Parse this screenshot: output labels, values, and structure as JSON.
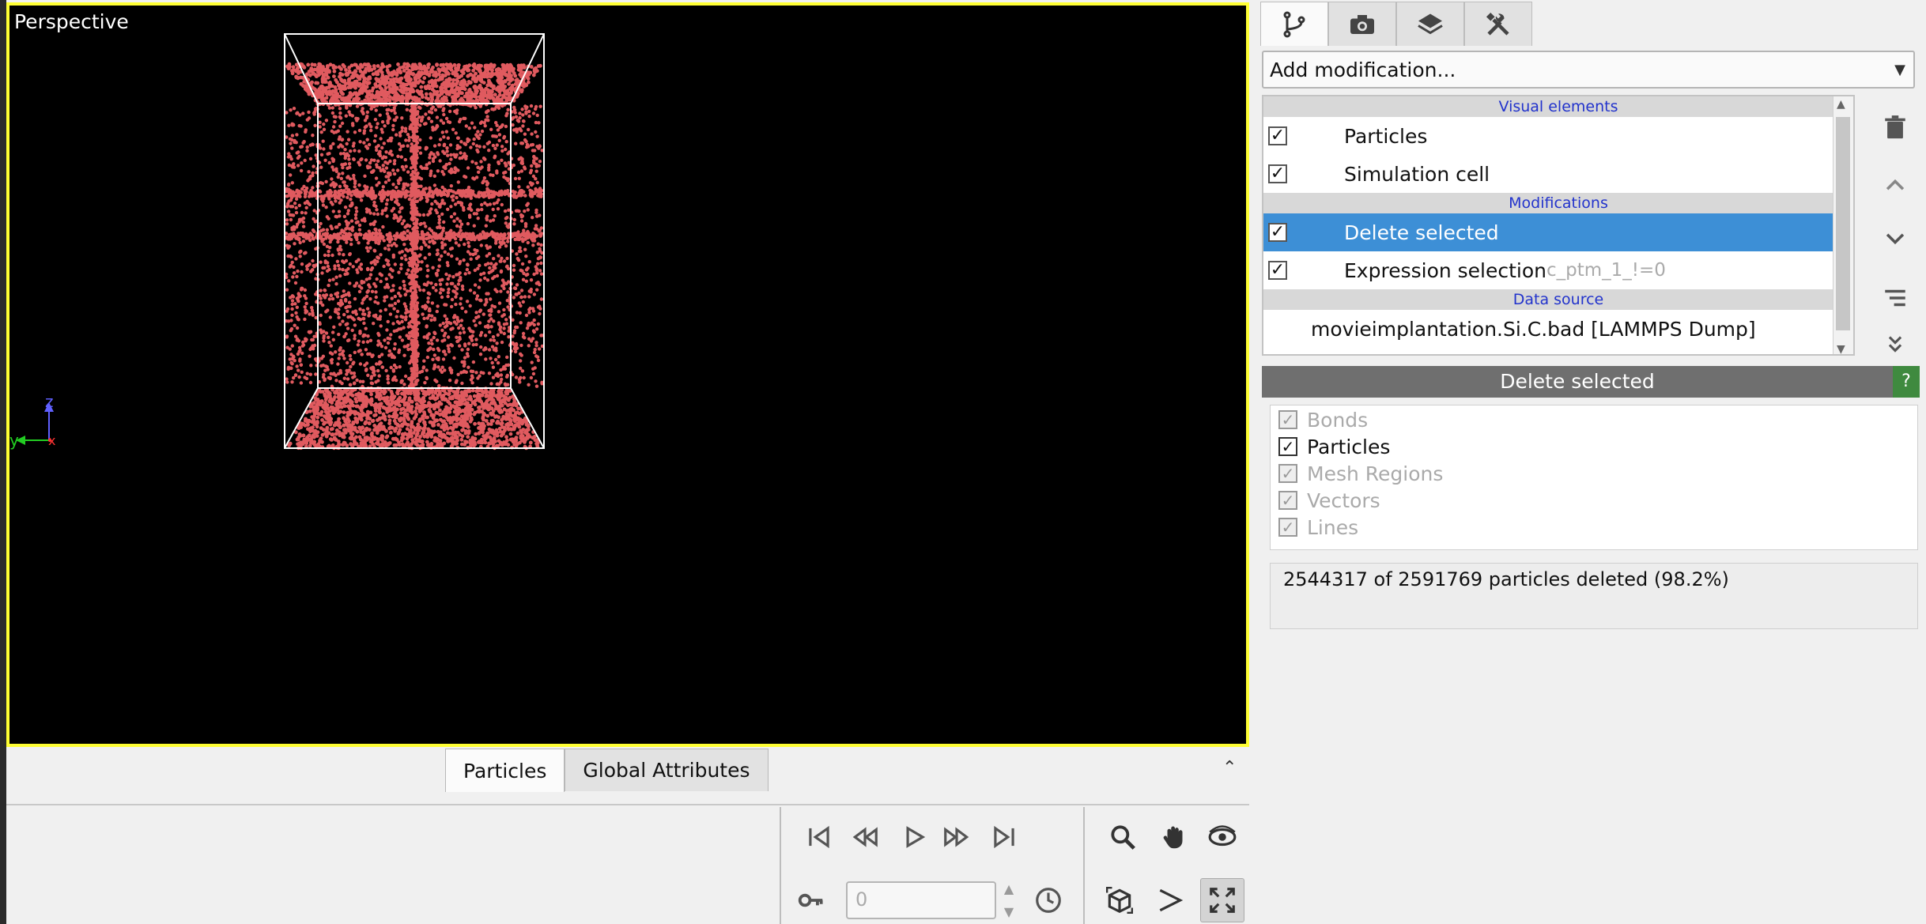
{
  "viewport": {
    "caption": "Perspective",
    "particle_color": "#e05a5f",
    "border_color": "#ffff33",
    "axes": {
      "z_label": "z",
      "y_label": "y",
      "x_label": "x"
    }
  },
  "data_tabs": [
    {
      "label": "Particles",
      "active": true
    },
    {
      "label": "Global Attributes",
      "active": false
    }
  ],
  "playback": {
    "frame_value": "0",
    "buttons": [
      "jump-to-start",
      "step-back",
      "play",
      "step-forward",
      "jump-to-end"
    ],
    "view_tools": [
      "zoom",
      "pan",
      "orbit",
      "zoom-scene-extents",
      "pick-orbit-center",
      "maximize-viewport"
    ]
  },
  "panel_tabs": [
    "pipeline-tab",
    "render-tab",
    "overlays-tab",
    "utilities-tab"
  ],
  "add_modification": {
    "label": "Add modification..."
  },
  "pipeline": {
    "sections": {
      "visual": "Visual elements",
      "modifications": "Modifications",
      "source": "Data source"
    },
    "visual_items": [
      {
        "label": "Particles",
        "checked": true
      },
      {
        "label": "Simulation cell",
        "checked": true
      }
    ],
    "modification_items": [
      {
        "label": "Delete selected",
        "checked": true,
        "selected": true,
        "extra": ""
      },
      {
        "label": "Expression selection",
        "checked": true,
        "selected": false,
        "extra": "c_ptm_1_!=0"
      }
    ],
    "source_item": {
      "label": "movieimplantation.Si.C.bad [LAMMPS Dump]"
    }
  },
  "editor": {
    "title": "Delete selected",
    "help": "?",
    "types": [
      {
        "label": "Bonds",
        "checked": true,
        "enabled": false
      },
      {
        "label": "Particles",
        "checked": true,
        "enabled": true
      },
      {
        "label": "Mesh Regions",
        "checked": true,
        "enabled": false
      },
      {
        "label": "Vectors",
        "checked": true,
        "enabled": false
      },
      {
        "label": "Lines",
        "checked": true,
        "enabled": false
      }
    ],
    "status": "2544317 of 2591769 particles deleted (98.2%)"
  }
}
